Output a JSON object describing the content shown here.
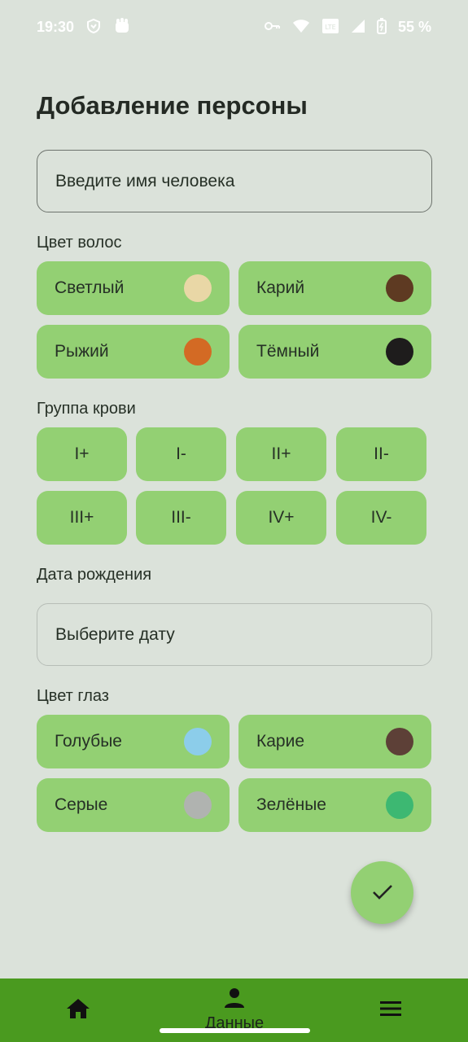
{
  "status_bar": {
    "time": "19:30",
    "battery": "55 %",
    "left_icons": [
      "vpn-shield-icon",
      "fist-icon"
    ],
    "right_icons": [
      "key-icon",
      "wifi-icon",
      "lte-icon",
      "signal-icon",
      "battery-icon"
    ]
  },
  "page": {
    "title": "Добавление персоны"
  },
  "name_field": {
    "placeholder": "Введите имя человека"
  },
  "hair": {
    "label": "Цвет волос",
    "options": [
      {
        "label": "Светлый",
        "color": "#e9d7a6"
      },
      {
        "label": "Карий",
        "color": "#5e3a22"
      },
      {
        "label": "Рыжий",
        "color": "#d36a24"
      },
      {
        "label": "Тёмный",
        "color": "#1e1c1c"
      }
    ]
  },
  "blood": {
    "label": "Группа крови",
    "options": [
      "I+",
      "I-",
      "II+",
      "II-",
      "III+",
      "III-",
      "IV+",
      "IV-"
    ]
  },
  "birth": {
    "label": "Дата рождения",
    "placeholder": "Выберите дату"
  },
  "eyes": {
    "label": "Цвет глаз",
    "options": [
      {
        "label": "Голубые",
        "color": "#8ccdea"
      },
      {
        "label": "Карие",
        "color": "#5d4037"
      },
      {
        "label": "Серые",
        "color": "#b0b3b0"
      },
      {
        "label": "Зелёные",
        "color": "#3db872"
      }
    ]
  },
  "fab": {
    "icon": "check-icon"
  },
  "bottom_nav": {
    "items": [
      {
        "icon": "home-icon",
        "label": ""
      },
      {
        "icon": "person-icon",
        "label": "Данные"
      },
      {
        "icon": "menu-icon",
        "label": ""
      }
    ]
  },
  "colors": {
    "background": "#dbe2da",
    "chip": "#93d073",
    "nav": "#4a9a1f"
  }
}
